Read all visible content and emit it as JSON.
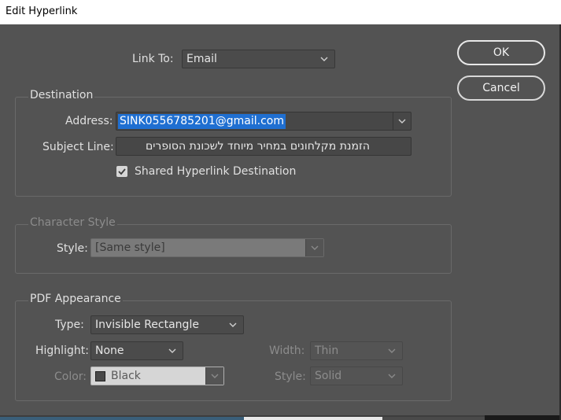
{
  "window": {
    "title": "Edit Hyperlink"
  },
  "link_to": {
    "label": "Link To:",
    "value": "Email"
  },
  "buttons": {
    "ok": "OK",
    "cancel": "Cancel"
  },
  "destination": {
    "legend": "Destination",
    "address_label": "Address:",
    "address_value": "SINK0556785201@gmail.com",
    "subject_label": "Subject Line:",
    "subject_value": "הזמנת מקלחונים במחיר מיוחד לשכונת הסופרים",
    "shared_label": "Shared Hyperlink Destination",
    "shared_checked": true
  },
  "character_style": {
    "legend": "Character Style",
    "style_label": "Style:",
    "style_value": "[Same style]"
  },
  "pdf_appearance": {
    "legend": "PDF Appearance",
    "type_label": "Type:",
    "type_value": "Invisible Rectangle",
    "highlight_label": "Highlight:",
    "highlight_value": "None",
    "width_label": "Width:",
    "width_value": "Thin",
    "color_label": "Color:",
    "color_value": "Black",
    "style_label": "Style:",
    "style_value": "Solid"
  }
}
